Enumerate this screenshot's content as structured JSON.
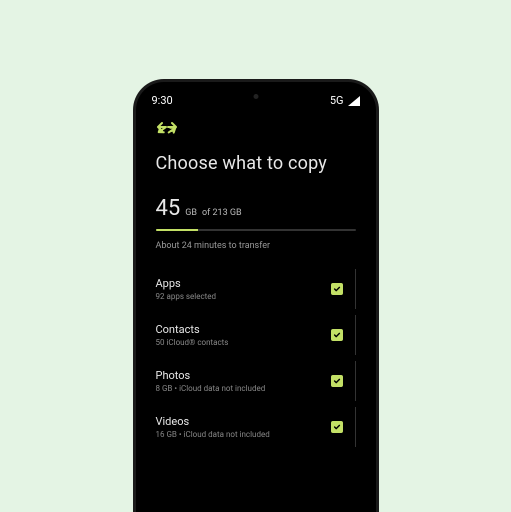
{
  "status": {
    "time": "9:30",
    "network": "5G"
  },
  "accent": "#c3e066",
  "title": "Choose what to copy",
  "storage": {
    "used": "45",
    "used_unit": "GB",
    "total_label": "of 213 GB",
    "progress_pct": 21
  },
  "eta": "About 24 minutes to transfer",
  "items": [
    {
      "title": "Apps",
      "subtitle": "92 apps selected",
      "checked": true
    },
    {
      "title": "Contacts",
      "subtitle": "50 iCloud® contacts",
      "checked": true
    },
    {
      "title": "Photos",
      "subtitle": "8 GB • iCloud data not included",
      "checked": true
    },
    {
      "title": "Videos",
      "subtitle": "16 GB • iCloud data not included",
      "checked": true
    }
  ]
}
